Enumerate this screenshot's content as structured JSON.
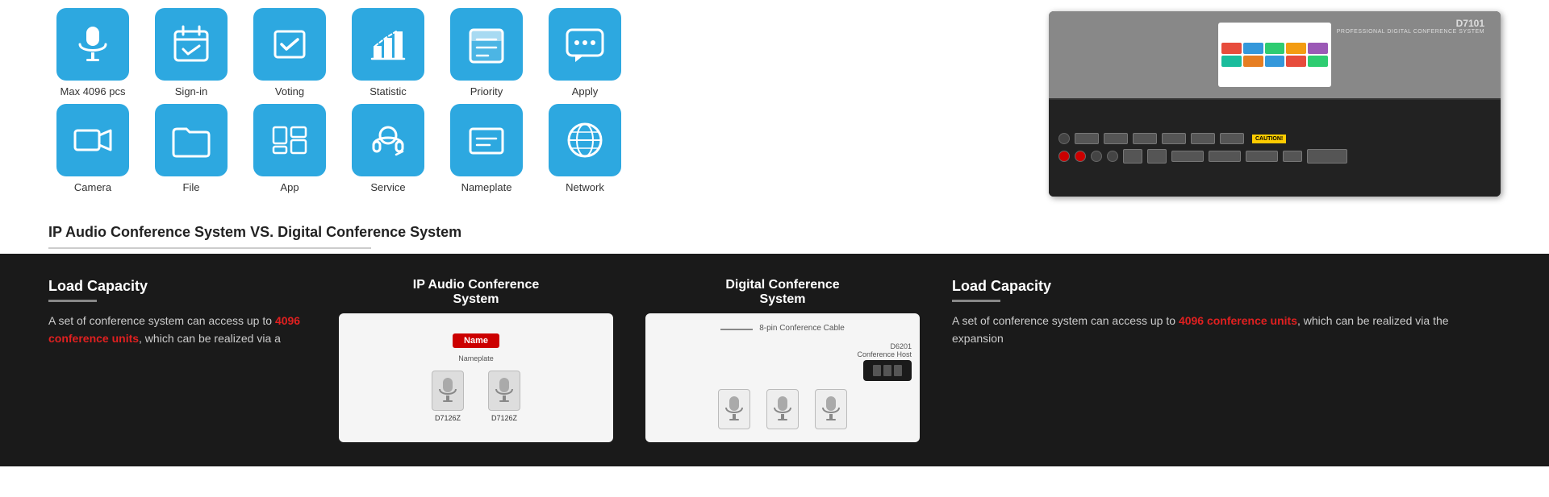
{
  "top": {
    "features": {
      "row1": [
        {
          "label": "Max 4096 pcs",
          "name": "max-4096"
        },
        {
          "label": "Sign-in",
          "name": "sign-in"
        },
        {
          "label": "Voting",
          "name": "voting"
        },
        {
          "label": "Statistic",
          "name": "statistic"
        },
        {
          "label": "Priority",
          "name": "priority"
        },
        {
          "label": "Apply",
          "name": "apply"
        }
      ],
      "row2": [
        {
          "label": "Camera",
          "name": "camera"
        },
        {
          "label": "File",
          "name": "file"
        },
        {
          "label": "App",
          "name": "app"
        },
        {
          "label": "Service",
          "name": "service"
        },
        {
          "label": "Nameplate",
          "name": "nameplate"
        },
        {
          "label": "Network",
          "name": "network"
        }
      ]
    },
    "product": {
      "model": "D7101",
      "description": "PROFESSIONAL DIGITAL CONFERENCE SYSTEM"
    }
  },
  "comparison": {
    "title": "IP Audio Conference System VS. Digital Conference System"
  },
  "bottom": {
    "load_capacity_left": {
      "title": "Load Capacity",
      "text_before": "A set of conference system can access up to ",
      "highlight": "4096 conference units",
      "text_after": ", which can be realized via a"
    },
    "ip_audio": {
      "title_line1": "IP Audio Conference",
      "title_line2": "System",
      "nameplate": "Name",
      "device1": "D7126Z",
      "device2": "D7126Z"
    },
    "digital": {
      "title_line1": "Digital Conference",
      "title_line2": "System",
      "cable_label": "8-pin Conference Cable",
      "host_title": "D6201",
      "host_subtitle": "Conference Host"
    },
    "load_capacity_right": {
      "title": "Load Capacity",
      "text_before": "A set of conference system can access up to ",
      "highlight": "4096 conference units",
      "text_after": ", which can be realized via the expansion"
    }
  }
}
